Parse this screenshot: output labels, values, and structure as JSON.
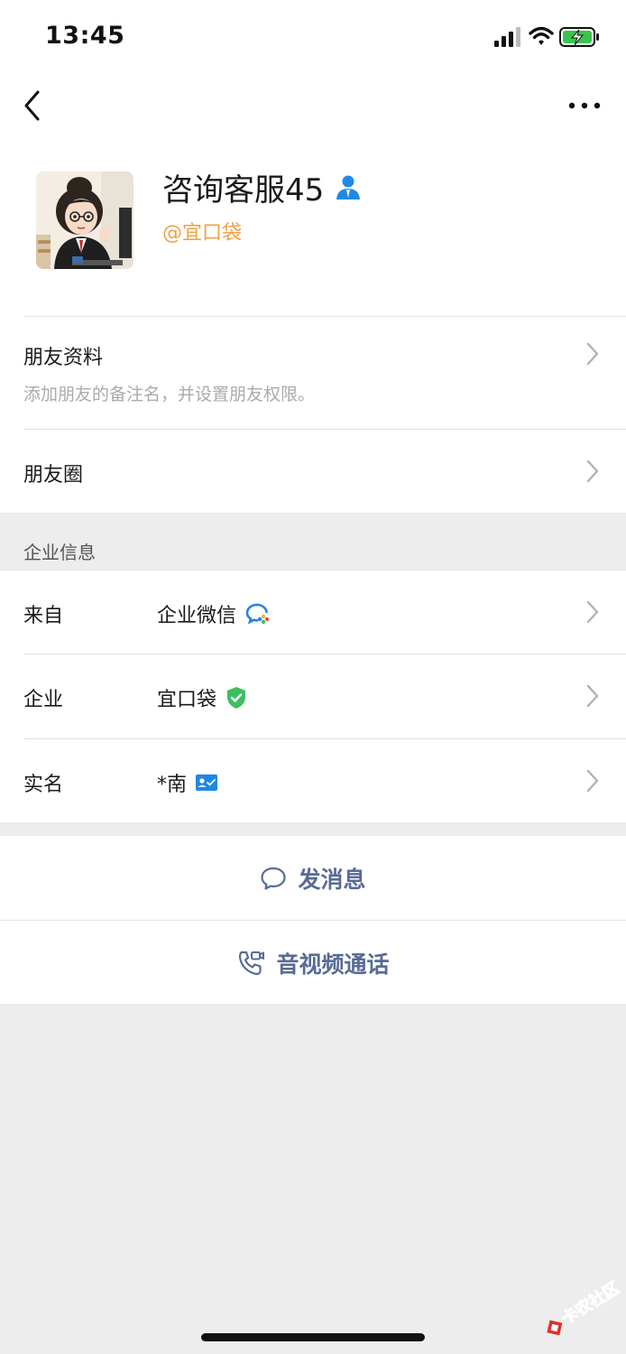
{
  "status_bar": {
    "time": "13:45"
  },
  "profile": {
    "name": "咨询客服45",
    "company_tag": "@宜口袋",
    "avatar_icon": "cartoon-woman-avatar",
    "person_icon_color": "#1f8ae6"
  },
  "friend_info": {
    "title": "朋友资料",
    "subtitle": "添加朋友的备注名，并设置朋友权限。"
  },
  "moments": {
    "title": "朋友圈"
  },
  "enterprise": {
    "section_title": "企业信息",
    "rows": [
      {
        "label": "来自",
        "value": "企业微信",
        "icon": "wecom-icon"
      },
      {
        "label": "企业",
        "value": "宜口袋",
        "icon": "verified-shield-icon"
      },
      {
        "label": "实名",
        "value": "*南",
        "icon": "id-card-icon"
      }
    ]
  },
  "actions": {
    "message": "发消息",
    "call": "音视频通话"
  },
  "watermark": {
    "text": "卡农社区"
  },
  "colors": {
    "link_blue": "#576b95",
    "company_orange": "#f0a043",
    "verified_green": "#3dbf60",
    "id_blue": "#1e88e5"
  }
}
